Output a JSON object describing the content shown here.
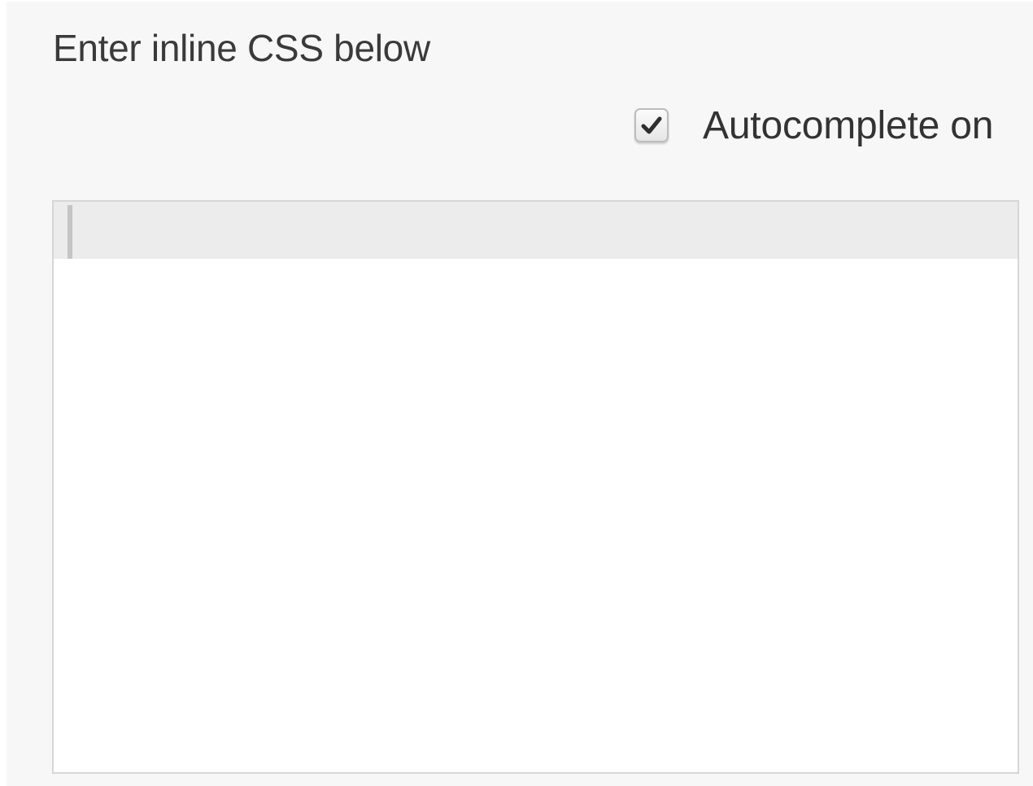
{
  "css_panel": {
    "heading": "Enter inline CSS below",
    "autocomplete": {
      "label": "Autocomplete on",
      "checked": true,
      "icon": "checkmark-icon"
    },
    "editor": {
      "content": ""
    }
  },
  "colors": {
    "panel_background": "#f7f7f7",
    "editor_background": "#ffffff",
    "active_line": "#ececec",
    "border": "#d6d6d6",
    "text": "#3a3a3a"
  }
}
